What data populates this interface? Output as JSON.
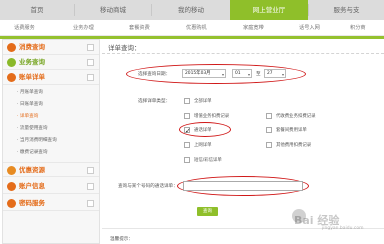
{
  "top_nav": {
    "tabs": [
      {
        "label": "首页"
      },
      {
        "label": "移动商城"
      },
      {
        "label": "我的移动"
      },
      {
        "label": "网上营业厅"
      },
      {
        "label": "服务与支"
      }
    ],
    "active_index": 3
  },
  "sub_nav": {
    "items": [
      {
        "label": "话费服务"
      },
      {
        "label": "业务办理"
      },
      {
        "label": "套餐资费"
      },
      {
        "label": "优惠购机"
      },
      {
        "label": "家庭宽带"
      },
      {
        "label": "话号入网"
      },
      {
        "label": "积分商"
      }
    ]
  },
  "sidebar": {
    "sections": [
      {
        "label": "消费查询",
        "icon": "coin-icon"
      },
      {
        "label": "业务查询",
        "icon": "search-icon"
      },
      {
        "label": "账单详单",
        "icon": "bill-icon"
      }
    ],
    "bill_items": [
      {
        "label": "· 月账单查询"
      },
      {
        "label": "· 日账单查询"
      },
      {
        "label": "· 详单查询"
      },
      {
        "label": "· 流量使用查询"
      },
      {
        "label": "· 当月消费明细查询"
      },
      {
        "label": "· 缴费记录查询"
      }
    ],
    "active_bill_index": 2,
    "more_sections": [
      {
        "label": "优惠资源",
        "icon": "gift-icon"
      },
      {
        "label": "账户信息",
        "icon": "account-icon"
      },
      {
        "label": "密码服务",
        "icon": "lock-icon"
      }
    ]
  },
  "main": {
    "title": "详单查询：",
    "date_label": "选择查询日期：",
    "date_month": "2015年03月",
    "date_from_day": "01",
    "date_sep": "至",
    "date_to_day": "27",
    "type_label": "选择详单类型：",
    "types": [
      {
        "label": "全部详单",
        "checked": false
      },
      {
        "label": "增值业务扣费记录",
        "checked": false
      },
      {
        "label": "代收费业务扣费记录",
        "checked": false
      },
      {
        "label": "通话详单",
        "checked": true
      },
      {
        "label": "套餐间费用详单",
        "checked": false
      },
      {
        "label": "上网详单",
        "checked": false
      },
      {
        "label": "其他费用扣费记录",
        "checked": false
      },
      {
        "label": "短信/彩信详单",
        "checked": false
      }
    ],
    "search_label": "查询与某个号码的通话详单：",
    "search_value": "",
    "query_button": "查询",
    "notice_label": "温馨提示："
  },
  "watermark": {
    "brand": "Bai 经验",
    "url": "jingyan.baidu.com"
  },
  "colors": {
    "accent_green": "#8fbf2a",
    "accent_orange": "#e46c1a",
    "highlight_red": "#d01818"
  }
}
